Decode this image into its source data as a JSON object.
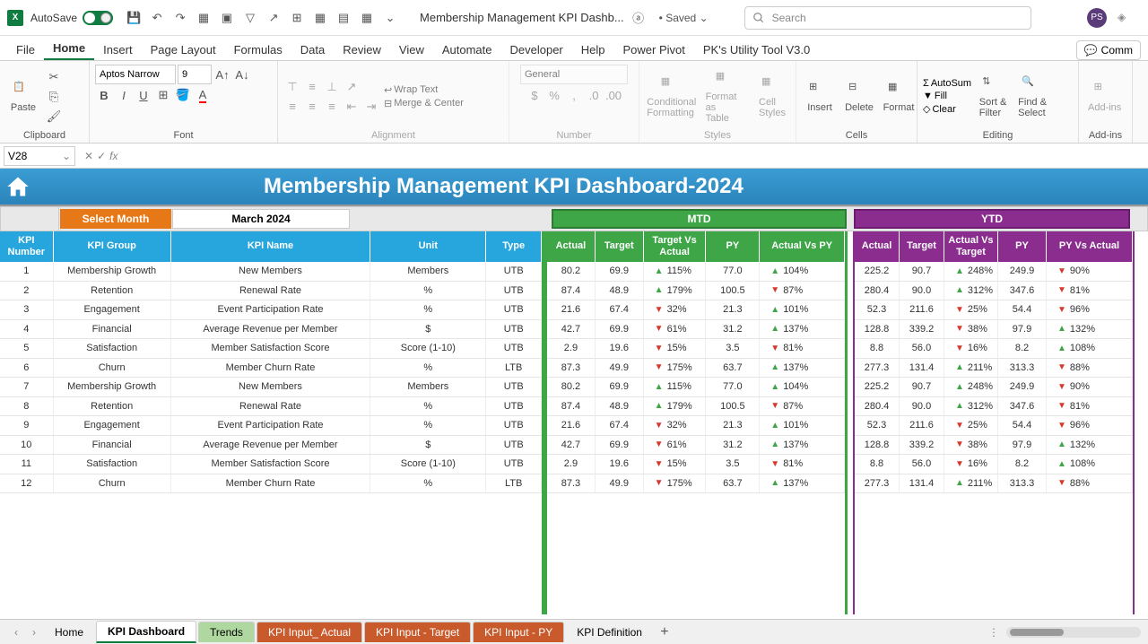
{
  "titlebar": {
    "autosave": "AutoSave",
    "autosave_on": "On",
    "doc_name": "Membership Management KPI Dashb...",
    "saved": "Saved",
    "search_placeholder": "Search",
    "avatar": "PS"
  },
  "menu": {
    "file": "File",
    "home": "Home",
    "insert": "Insert",
    "pagelayout": "Page Layout",
    "formulas": "Formulas",
    "data": "Data",
    "review": "Review",
    "view": "View",
    "automate": "Automate",
    "developer": "Developer",
    "help": "Help",
    "powerpivot": "Power Pivot",
    "pk": "PK's Utility Tool V3.0",
    "comments": "Comm"
  },
  "ribbon": {
    "paste": "Paste",
    "font": "Aptos Narrow",
    "size": "9",
    "wrap": "Wrap Text",
    "merge": "Merge & Center",
    "numfmt": "General",
    "condfmt": "Conditional\nFormatting",
    "fmttbl": "Format as\nTable",
    "cellsty": "Cell\nStyles",
    "insert": "Insert",
    "delete": "Delete",
    "format": "Format",
    "autosum": "AutoSum",
    "fill": "Fill",
    "clear": "Clear",
    "sort": "Sort &\nFilter",
    "find": "Find &\nSelect",
    "addins": "Add-ins",
    "g_clipboard": "Clipboard",
    "g_font": "Font",
    "g_align": "Alignment",
    "g_number": "Number",
    "g_styles": "Styles",
    "g_cells": "Cells",
    "g_editing": "Editing",
    "g_addins": "Add-ins"
  },
  "namebox": "V28",
  "dashboard": {
    "title": "Membership Management KPI Dashboard-2024",
    "select_month": "Select Month",
    "month": "March 2024",
    "mtd": "MTD",
    "ytd": "YTD"
  },
  "info_headers": {
    "num": "KPI\nNumber",
    "group": "KPI Group",
    "name": "KPI Name",
    "unit": "Unit",
    "type": "Type"
  },
  "mtd_headers": {
    "actual": "Actual",
    "target": "Target",
    "tva": "Target Vs\nActual",
    "py": "PY",
    "avp": "Actual Vs PY"
  },
  "ytd_headers": {
    "actual": "Actual",
    "target": "Target",
    "avt": "Actual Vs\nTarget",
    "py": "PY",
    "pva": "PY Vs Actual"
  },
  "rows": [
    {
      "n": "1",
      "grp": "Membership Growth",
      "name": "New Members",
      "unit": "Members",
      "type": "UTB",
      "ma": "80.2",
      "mt": "69.9",
      "mtva": "115%",
      "mtu": true,
      "mpy": "77.0",
      "mavp": "104%",
      "mau": true,
      "ya": "225.2",
      "yt": "90.7",
      "yavt": "248%",
      "yau": true,
      "ypy": "249.9",
      "ypva": "90%",
      "ypu": false
    },
    {
      "n": "2",
      "grp": "Retention",
      "name": "Renewal Rate",
      "unit": "%",
      "type": "UTB",
      "ma": "87.4",
      "mt": "48.9",
      "mtva": "179%",
      "mtu": true,
      "mpy": "100.5",
      "mavp": "87%",
      "mau": false,
      "ya": "280.4",
      "yt": "90.0",
      "yavt": "312%",
      "yau": true,
      "ypy": "347.6",
      "ypva": "81%",
      "ypu": false
    },
    {
      "n": "3",
      "grp": "Engagement",
      "name": "Event Participation Rate",
      "unit": "%",
      "type": "UTB",
      "ma": "21.6",
      "mt": "67.4",
      "mtva": "32%",
      "mtu": false,
      "mpy": "21.3",
      "mavp": "101%",
      "mau": true,
      "ya": "52.3",
      "yt": "211.6",
      "yavt": "25%",
      "yau": false,
      "ypy": "54.4",
      "ypva": "96%",
      "ypu": false
    },
    {
      "n": "4",
      "grp": "Financial",
      "name": "Average Revenue per Member",
      "unit": "$",
      "type": "UTB",
      "ma": "42.7",
      "mt": "69.9",
      "mtva": "61%",
      "mtu": false,
      "mpy": "31.2",
      "mavp": "137%",
      "mau": true,
      "ya": "128.8",
      "yt": "339.2",
      "yavt": "38%",
      "yau": false,
      "ypy": "97.9",
      "ypva": "132%",
      "ypu": true
    },
    {
      "n": "5",
      "grp": "Satisfaction",
      "name": "Member Satisfaction Score",
      "unit": "Score (1-10)",
      "type": "UTB",
      "ma": "2.9",
      "mt": "19.6",
      "mtva": "15%",
      "mtu": false,
      "mpy": "3.5",
      "mavp": "81%",
      "mau": false,
      "ya": "8.8",
      "yt": "56.0",
      "yavt": "16%",
      "yau": false,
      "ypy": "8.2",
      "ypva": "108%",
      "ypu": true
    },
    {
      "n": "6",
      "grp": "Churn",
      "name": "Member Churn Rate",
      "unit": "%",
      "type": "LTB",
      "ma": "87.3",
      "mt": "49.9",
      "mtva": "175%",
      "mtu": false,
      "mpy": "63.7",
      "mavp": "137%",
      "mau": true,
      "ya": "277.3",
      "yt": "131.4",
      "yavt": "211%",
      "yau": true,
      "ypy": "313.3",
      "ypva": "88%",
      "ypu": false
    },
    {
      "n": "7",
      "grp": "Membership Growth",
      "name": "New Members",
      "unit": "Members",
      "type": "UTB",
      "ma": "80.2",
      "mt": "69.9",
      "mtva": "115%",
      "mtu": true,
      "mpy": "77.0",
      "mavp": "104%",
      "mau": true,
      "ya": "225.2",
      "yt": "90.7",
      "yavt": "248%",
      "yau": true,
      "ypy": "249.9",
      "ypva": "90%",
      "ypu": false
    },
    {
      "n": "8",
      "grp": "Retention",
      "name": "Renewal Rate",
      "unit": "%",
      "type": "UTB",
      "ma": "87.4",
      "mt": "48.9",
      "mtva": "179%",
      "mtu": true,
      "mpy": "100.5",
      "mavp": "87%",
      "mau": false,
      "ya": "280.4",
      "yt": "90.0",
      "yavt": "312%",
      "yau": true,
      "ypy": "347.6",
      "ypva": "81%",
      "ypu": false
    },
    {
      "n": "9",
      "grp": "Engagement",
      "name": "Event Participation Rate",
      "unit": "%",
      "type": "UTB",
      "ma": "21.6",
      "mt": "67.4",
      "mtva": "32%",
      "mtu": false,
      "mpy": "21.3",
      "mavp": "101%",
      "mau": true,
      "ya": "52.3",
      "yt": "211.6",
      "yavt": "25%",
      "yau": false,
      "ypy": "54.4",
      "ypva": "96%",
      "ypu": false
    },
    {
      "n": "10",
      "grp": "Financial",
      "name": "Average Revenue per Member",
      "unit": "$",
      "type": "UTB",
      "ma": "42.7",
      "mt": "69.9",
      "mtva": "61%",
      "mtu": false,
      "mpy": "31.2",
      "mavp": "137%",
      "mau": true,
      "ya": "128.8",
      "yt": "339.2",
      "yavt": "38%",
      "yau": false,
      "ypy": "97.9",
      "ypva": "132%",
      "ypu": true
    },
    {
      "n": "11",
      "grp": "Satisfaction",
      "name": "Member Satisfaction Score",
      "unit": "Score (1-10)",
      "type": "UTB",
      "ma": "2.9",
      "mt": "19.6",
      "mtva": "15%",
      "mtu": false,
      "mpy": "3.5",
      "mavp": "81%",
      "mau": false,
      "ya": "8.8",
      "yt": "56.0",
      "yavt": "16%",
      "yau": false,
      "ypy": "8.2",
      "ypva": "108%",
      "ypu": true
    },
    {
      "n": "12",
      "grp": "Churn",
      "name": "Member Churn Rate",
      "unit": "%",
      "type": "LTB",
      "ma": "87.3",
      "mt": "49.9",
      "mtva": "175%",
      "mtu": false,
      "mpy": "63.7",
      "mavp": "137%",
      "mau": true,
      "ya": "277.3",
      "yt": "131.4",
      "yavt": "211%",
      "yau": true,
      "ypy": "313.3",
      "ypva": "88%",
      "ypu": false
    }
  ],
  "tabs": {
    "home": "Home",
    "dash": "KPI Dashboard",
    "trends": "Trends",
    "actual": "KPI Input_ Actual",
    "target": "KPI Input - Target",
    "py": "KPI Input - PY",
    "def": "KPI Definition"
  }
}
